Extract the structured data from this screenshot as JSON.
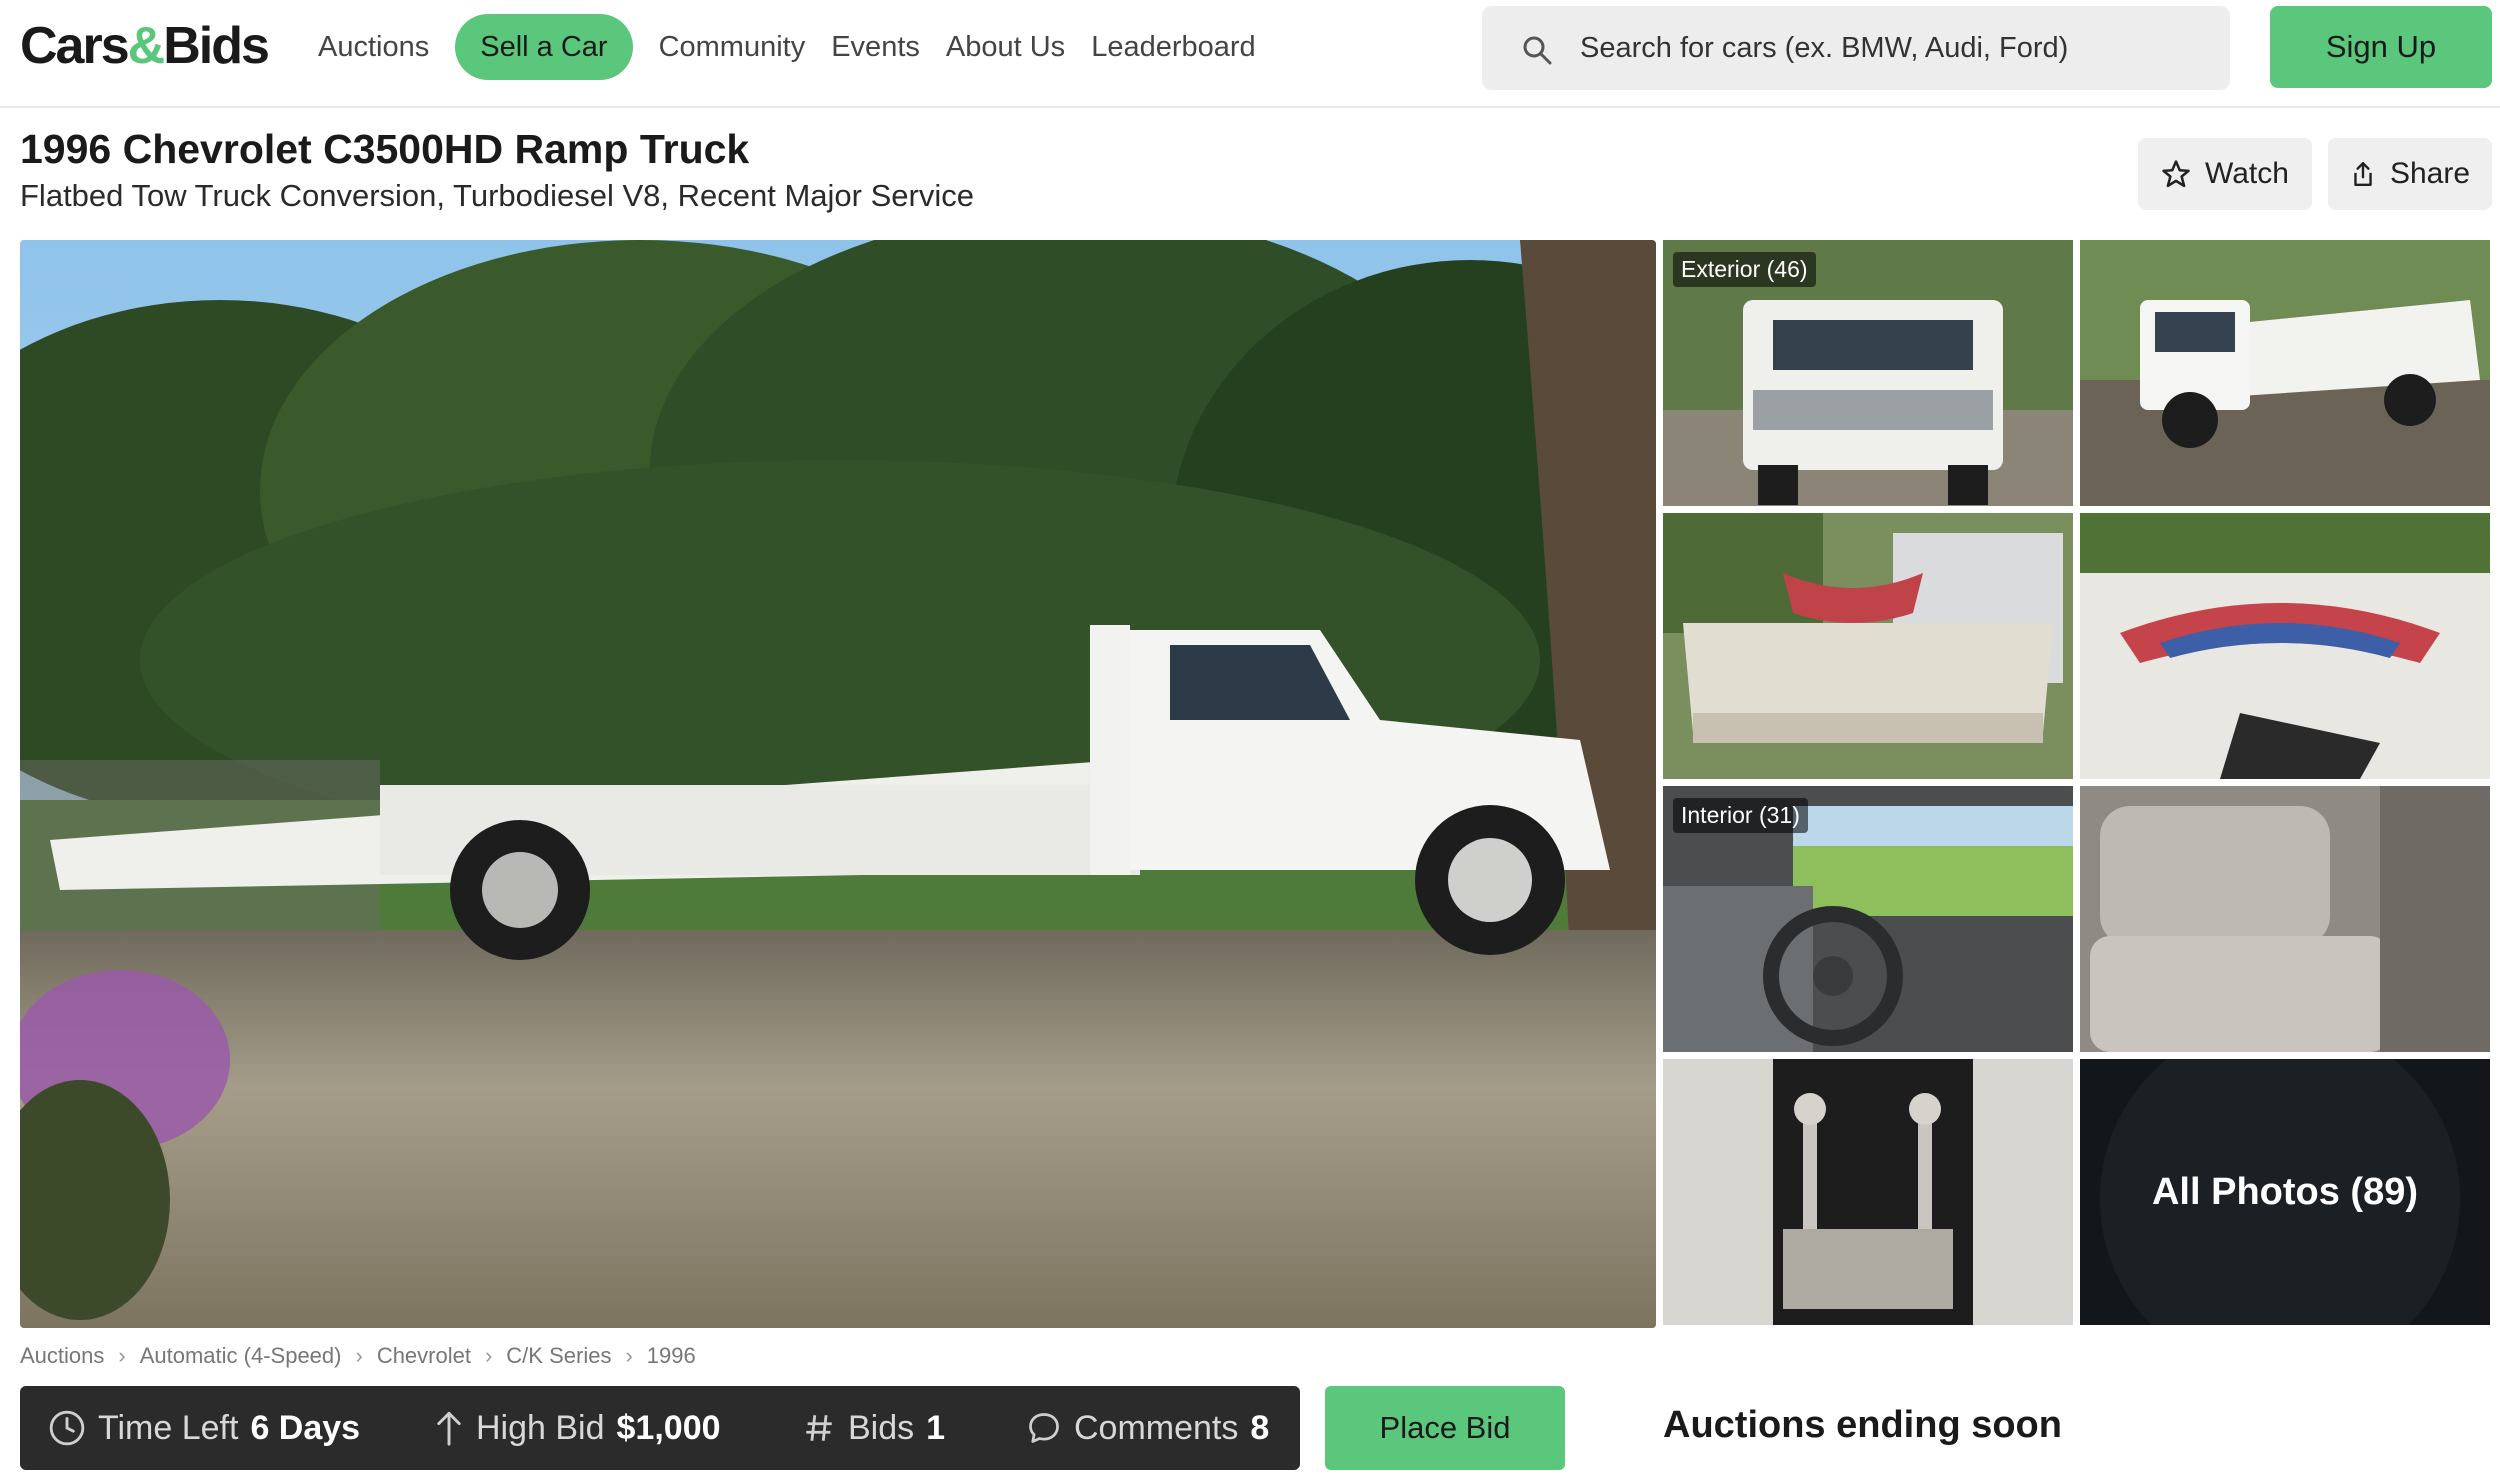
{
  "brand": {
    "logo_left": "Cars",
    "logo_amp": "&",
    "logo_right": "Bids",
    "accent": "#5bc77c"
  },
  "nav": {
    "auctions": "Auctions",
    "sell": "Sell a Car",
    "community": "Community",
    "events": "Events",
    "about": "About Us",
    "leaderboard": "Leaderboard"
  },
  "search": {
    "placeholder": "Search for cars (ex. BMW, Audi, Ford)",
    "icon": "search-icon"
  },
  "signup": "Sign Up",
  "listing": {
    "title": "1996 Chevrolet C3500HD Ramp Truck",
    "subtitle": "Flatbed Tow Truck Conversion, Turbodiesel V8, Recent Major Service",
    "watch": "Watch",
    "share": "Share"
  },
  "gallery": {
    "exterior_label": "Exterior (46)",
    "interior_label": "Interior (31)",
    "all_photos": "All Photos (89)"
  },
  "breadcrumb": [
    "Auctions",
    "Automatic (4-Speed)",
    "Chevrolet",
    "C/K Series",
    "1996"
  ],
  "bid": {
    "time_label": "Time Left",
    "time_value": "6 Days",
    "high_label": "High Bid",
    "high_value": "$1,000",
    "bids_label": "Bids",
    "bids_value": "1",
    "comments_label": "Comments",
    "comments_value": "8",
    "place_bid": "Place Bid"
  },
  "ending_soon": "Auctions ending soon"
}
